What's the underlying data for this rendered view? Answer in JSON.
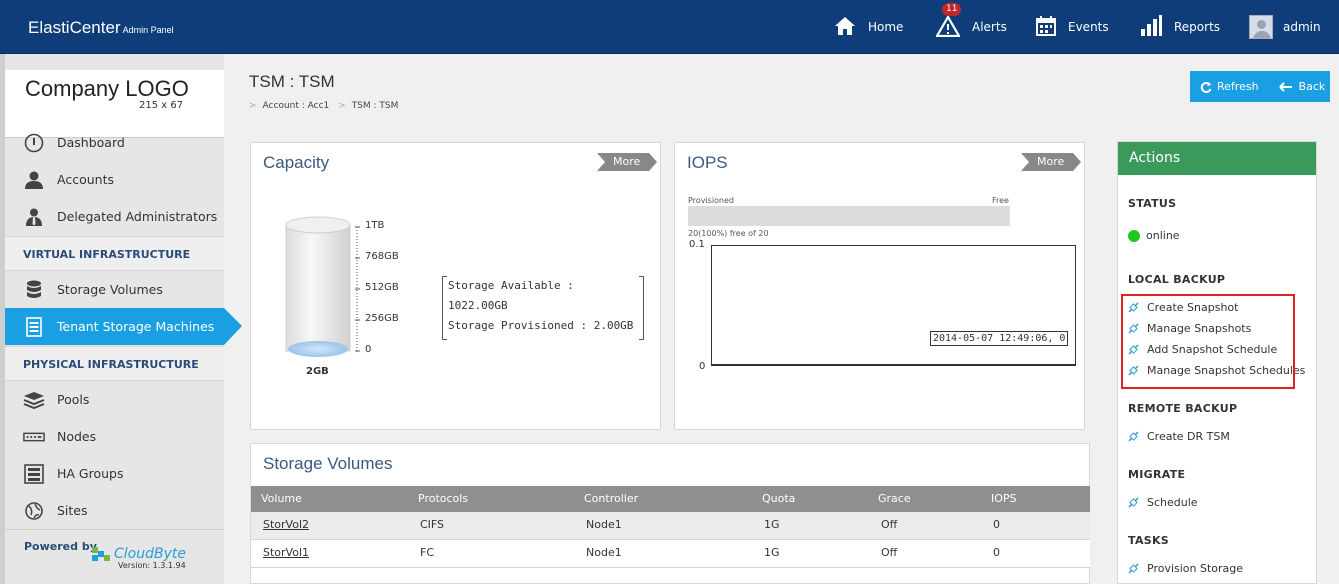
{
  "header": {
    "brand": "ElastiCenter",
    "brand_sub": "Admin Panel",
    "nav": [
      {
        "label": "Home",
        "icon": "home-icon"
      },
      {
        "label": "Alerts",
        "icon": "alert-icon",
        "badge": "11"
      },
      {
        "label": "Events",
        "icon": "calendar-icon"
      },
      {
        "label": "Reports",
        "icon": "bar-chart-icon"
      },
      {
        "label": "admin",
        "icon": "user-avatar"
      }
    ]
  },
  "sidebar": {
    "logo_title": "Company LOGO",
    "logo_size": "215 x 67",
    "items": [
      {
        "label": "Dashboard",
        "icon": "dashboard-icon"
      },
      {
        "label": "Accounts",
        "icon": "user-icon"
      },
      {
        "label": "Delegated Administrators",
        "icon": "admin-icon"
      },
      {
        "label": "Storage Volumes",
        "icon": "database-icon"
      },
      {
        "label": "Tenant Storage Machines",
        "icon": "tsm-icon",
        "active": true
      },
      {
        "label": "Pools",
        "icon": "layers-icon"
      },
      {
        "label": "Nodes",
        "icon": "node-icon"
      },
      {
        "label": "HA Groups",
        "icon": "server-rack-icon"
      },
      {
        "label": "Sites",
        "icon": "globe-icon"
      }
    ],
    "sections": [
      "VIRTUAL INFRASTRUCTURE",
      "PHYSICAL INFRASTRUCTURE"
    ],
    "powered_by": "Powered by",
    "vendor": "CloudByte",
    "version": "Version: 1.3.1.94"
  },
  "page": {
    "title": "TSM : TSM",
    "breadcrumb": [
      "Account : Acc1",
      "TSM : TSM"
    ],
    "refresh_label": "Refresh",
    "back_label": "Back"
  },
  "capacity": {
    "title": "Capacity",
    "more": "More",
    "ticks": [
      "1TB",
      "768GB",
      "512GB",
      "256GB",
      "0"
    ],
    "cylinder_label": "2GB",
    "available": "Storage Available : 1022.00GB",
    "provisioned": "Storage Provisioned : 2.00GB"
  },
  "iops": {
    "title": "IOPS",
    "more": "More",
    "bar_left": "Provisioned",
    "bar_right": "Free",
    "bar_caption": "20(100%) free of 20",
    "y_max": "0.1",
    "y_min": "0",
    "tooltip": "2014-05-07 12:49:06, 0"
  },
  "volumes": {
    "title": "Storage Volumes",
    "columns": [
      "Volume",
      "Protocols",
      "Controller",
      "Quota",
      "Grace",
      "IOPS"
    ],
    "rows": [
      [
        "StorVol2",
        "CIFS",
        "Node1",
        "1G",
        "Off",
        "0"
      ],
      [
        "StorVol1",
        "FC",
        "Node1",
        "1G",
        "Off",
        "0"
      ]
    ]
  },
  "actions": {
    "title": "Actions",
    "status_head": "STATUS",
    "status_value": "online",
    "status_color": "#1ec81e",
    "local_head": "LOCAL BACKUP",
    "local_links": [
      "Create Snapshot",
      "Manage Snapshots",
      "Add Snapshot Schedule",
      "Manage Snapshot Schedules"
    ],
    "remote_head": "REMOTE BACKUP",
    "remote_links": [
      "Create DR TSM"
    ],
    "migrate_head": "MIGRATE",
    "migrate_links": [
      "Schedule"
    ],
    "tasks_head": "TASKS",
    "tasks_links": [
      "Provision Storage"
    ]
  }
}
